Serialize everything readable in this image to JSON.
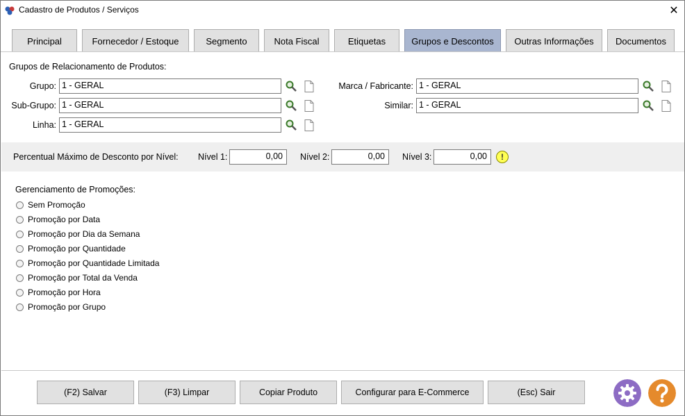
{
  "window": {
    "title": "Cadastro de Produtos / Serviços",
    "close_glyph": "✕"
  },
  "tabs": [
    {
      "label": "Principal",
      "active": false
    },
    {
      "label": "Fornecedor / Estoque",
      "active": false
    },
    {
      "label": "Segmento",
      "active": false
    },
    {
      "label": "Nota Fiscal",
      "active": false
    },
    {
      "label": "Etiquetas",
      "active": false
    },
    {
      "label": "Grupos e Descontos",
      "active": true
    },
    {
      "label": "Outras Informações",
      "active": false
    },
    {
      "label": "Documentos",
      "active": false
    }
  ],
  "groups": {
    "section_title": "Grupos de Relacionamento de Produtos:",
    "grupo": {
      "label": "Grupo:",
      "value": "1 - GERAL"
    },
    "subgrupo": {
      "label": "Sub-Grupo:",
      "value": "1 - GERAL"
    },
    "linha": {
      "label": "Linha:",
      "value": "1 - GERAL"
    },
    "marca": {
      "label": "Marca / Fabricante:",
      "value": "1 - GERAL"
    },
    "similar": {
      "label": "Similar:",
      "value": "1 - GERAL"
    }
  },
  "discount": {
    "label": "Percentual Máximo de Desconto por Nível:",
    "nivel1": {
      "label": "Nível 1:",
      "value": "0,00"
    },
    "nivel2": {
      "label": "Nível 2:",
      "value": "0,00"
    },
    "nivel3": {
      "label": "Nível 3:",
      "value": "0,00"
    },
    "warning_glyph": "!"
  },
  "promotions": {
    "title": "Gerenciamento de Promoções:",
    "options": [
      "Sem Promoção",
      "Promoção por Data",
      "Promoção por Dia da Semana",
      "Promoção por Quantidade",
      "Promoção por Quantidade Limitada",
      "Promoção por Total da Venda",
      "Promoção por Hora",
      "Promoção por Grupo"
    ],
    "selected": null
  },
  "buttons": {
    "salvar": "(F2) Salvar",
    "limpar": "(F3) Limpar",
    "copiar": "Copiar Produto",
    "ecommerce": "Configurar para E-Commerce",
    "sair": "(Esc) Sair"
  },
  "colors": {
    "active_tab": "#a9b6d0",
    "gear": "#8d6cc4",
    "help": "#e58a2c",
    "warning": "#ffff55"
  }
}
